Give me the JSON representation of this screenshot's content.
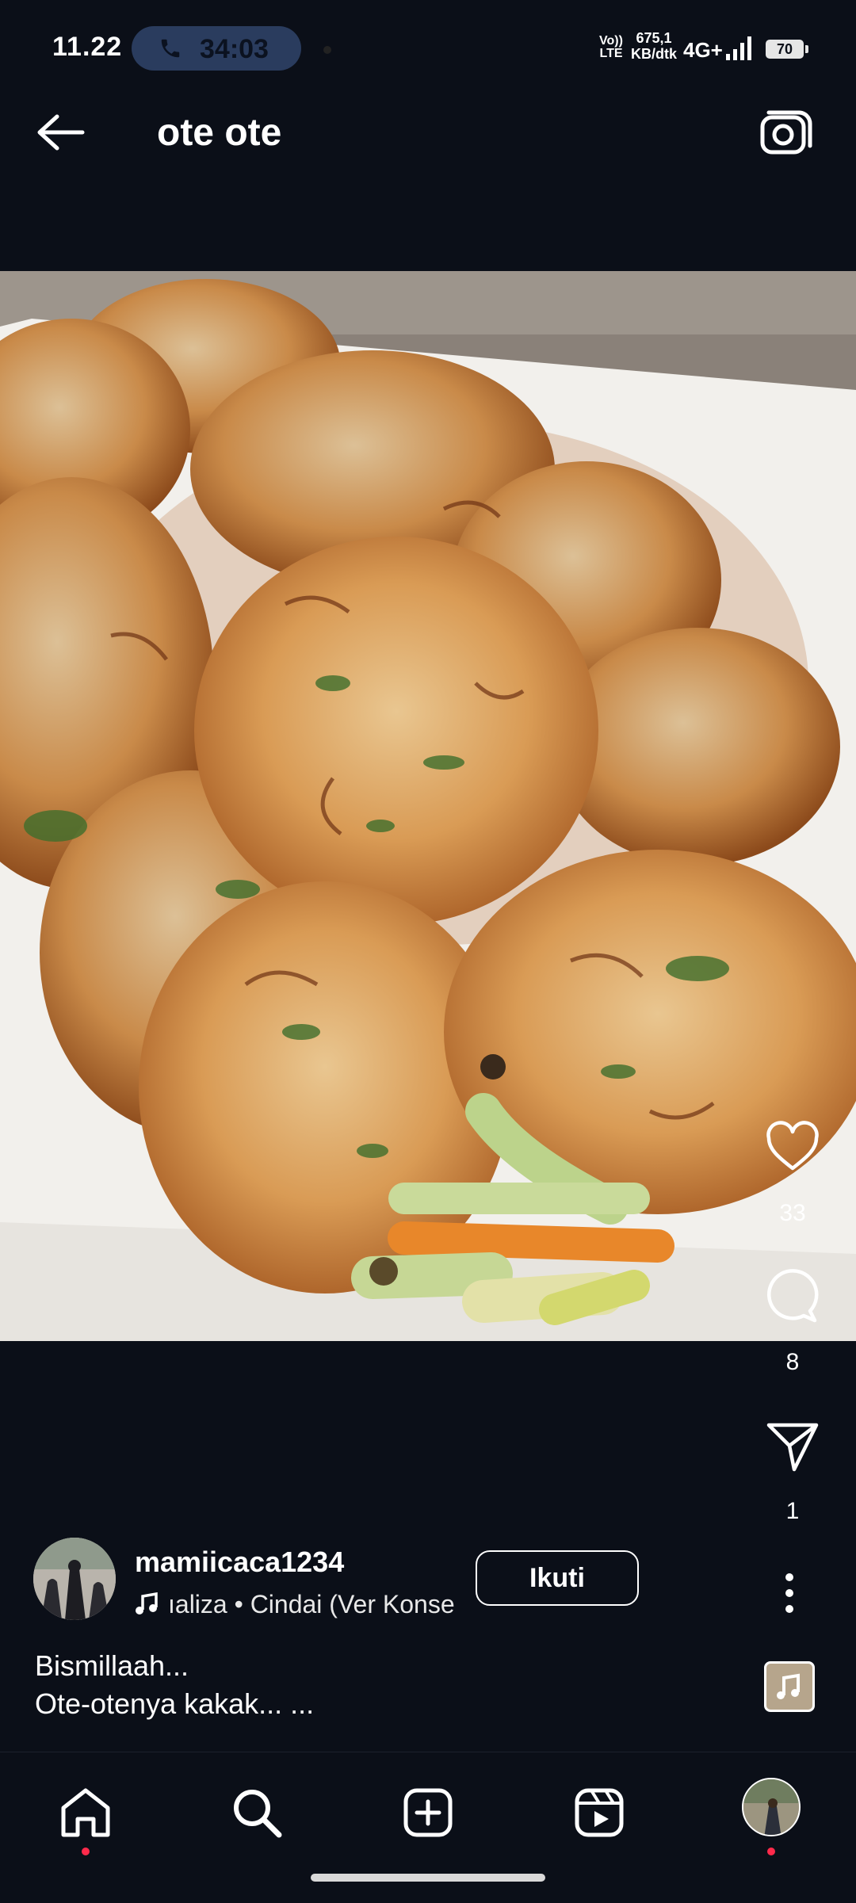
{
  "status_bar": {
    "time": "11.22",
    "call_duration": "34:03",
    "volte_label": "Vo)) LTE",
    "net_speed_value": "675,1",
    "net_speed_unit": "KB/dtk",
    "network_type": "4G+",
    "battery": "70"
  },
  "header": {
    "title": "ote ote"
  },
  "actions": {
    "likes": "33",
    "comments": "8",
    "shares": "1"
  },
  "author": {
    "username": "mamiicaca1234",
    "music": "ıaliza • Cindai (Ver Konse",
    "follow_label": "Ikuti"
  },
  "caption": {
    "line1": "Bismillaah...",
    "line2": "Ote-otenya kakak... ..."
  },
  "colors": {
    "background": "#0b0f18",
    "notification_dot": "#ff2a4b",
    "call_pill": "#2a3c5e"
  },
  "icons": {
    "back": "arrow-left-icon",
    "camera": "camera-icon",
    "like": "heart-icon",
    "comment": "comment-icon",
    "share": "send-icon",
    "more": "more-vertical-icon",
    "home": "home-icon",
    "search": "search-icon",
    "create": "plus-square-icon",
    "reels": "reels-icon"
  }
}
